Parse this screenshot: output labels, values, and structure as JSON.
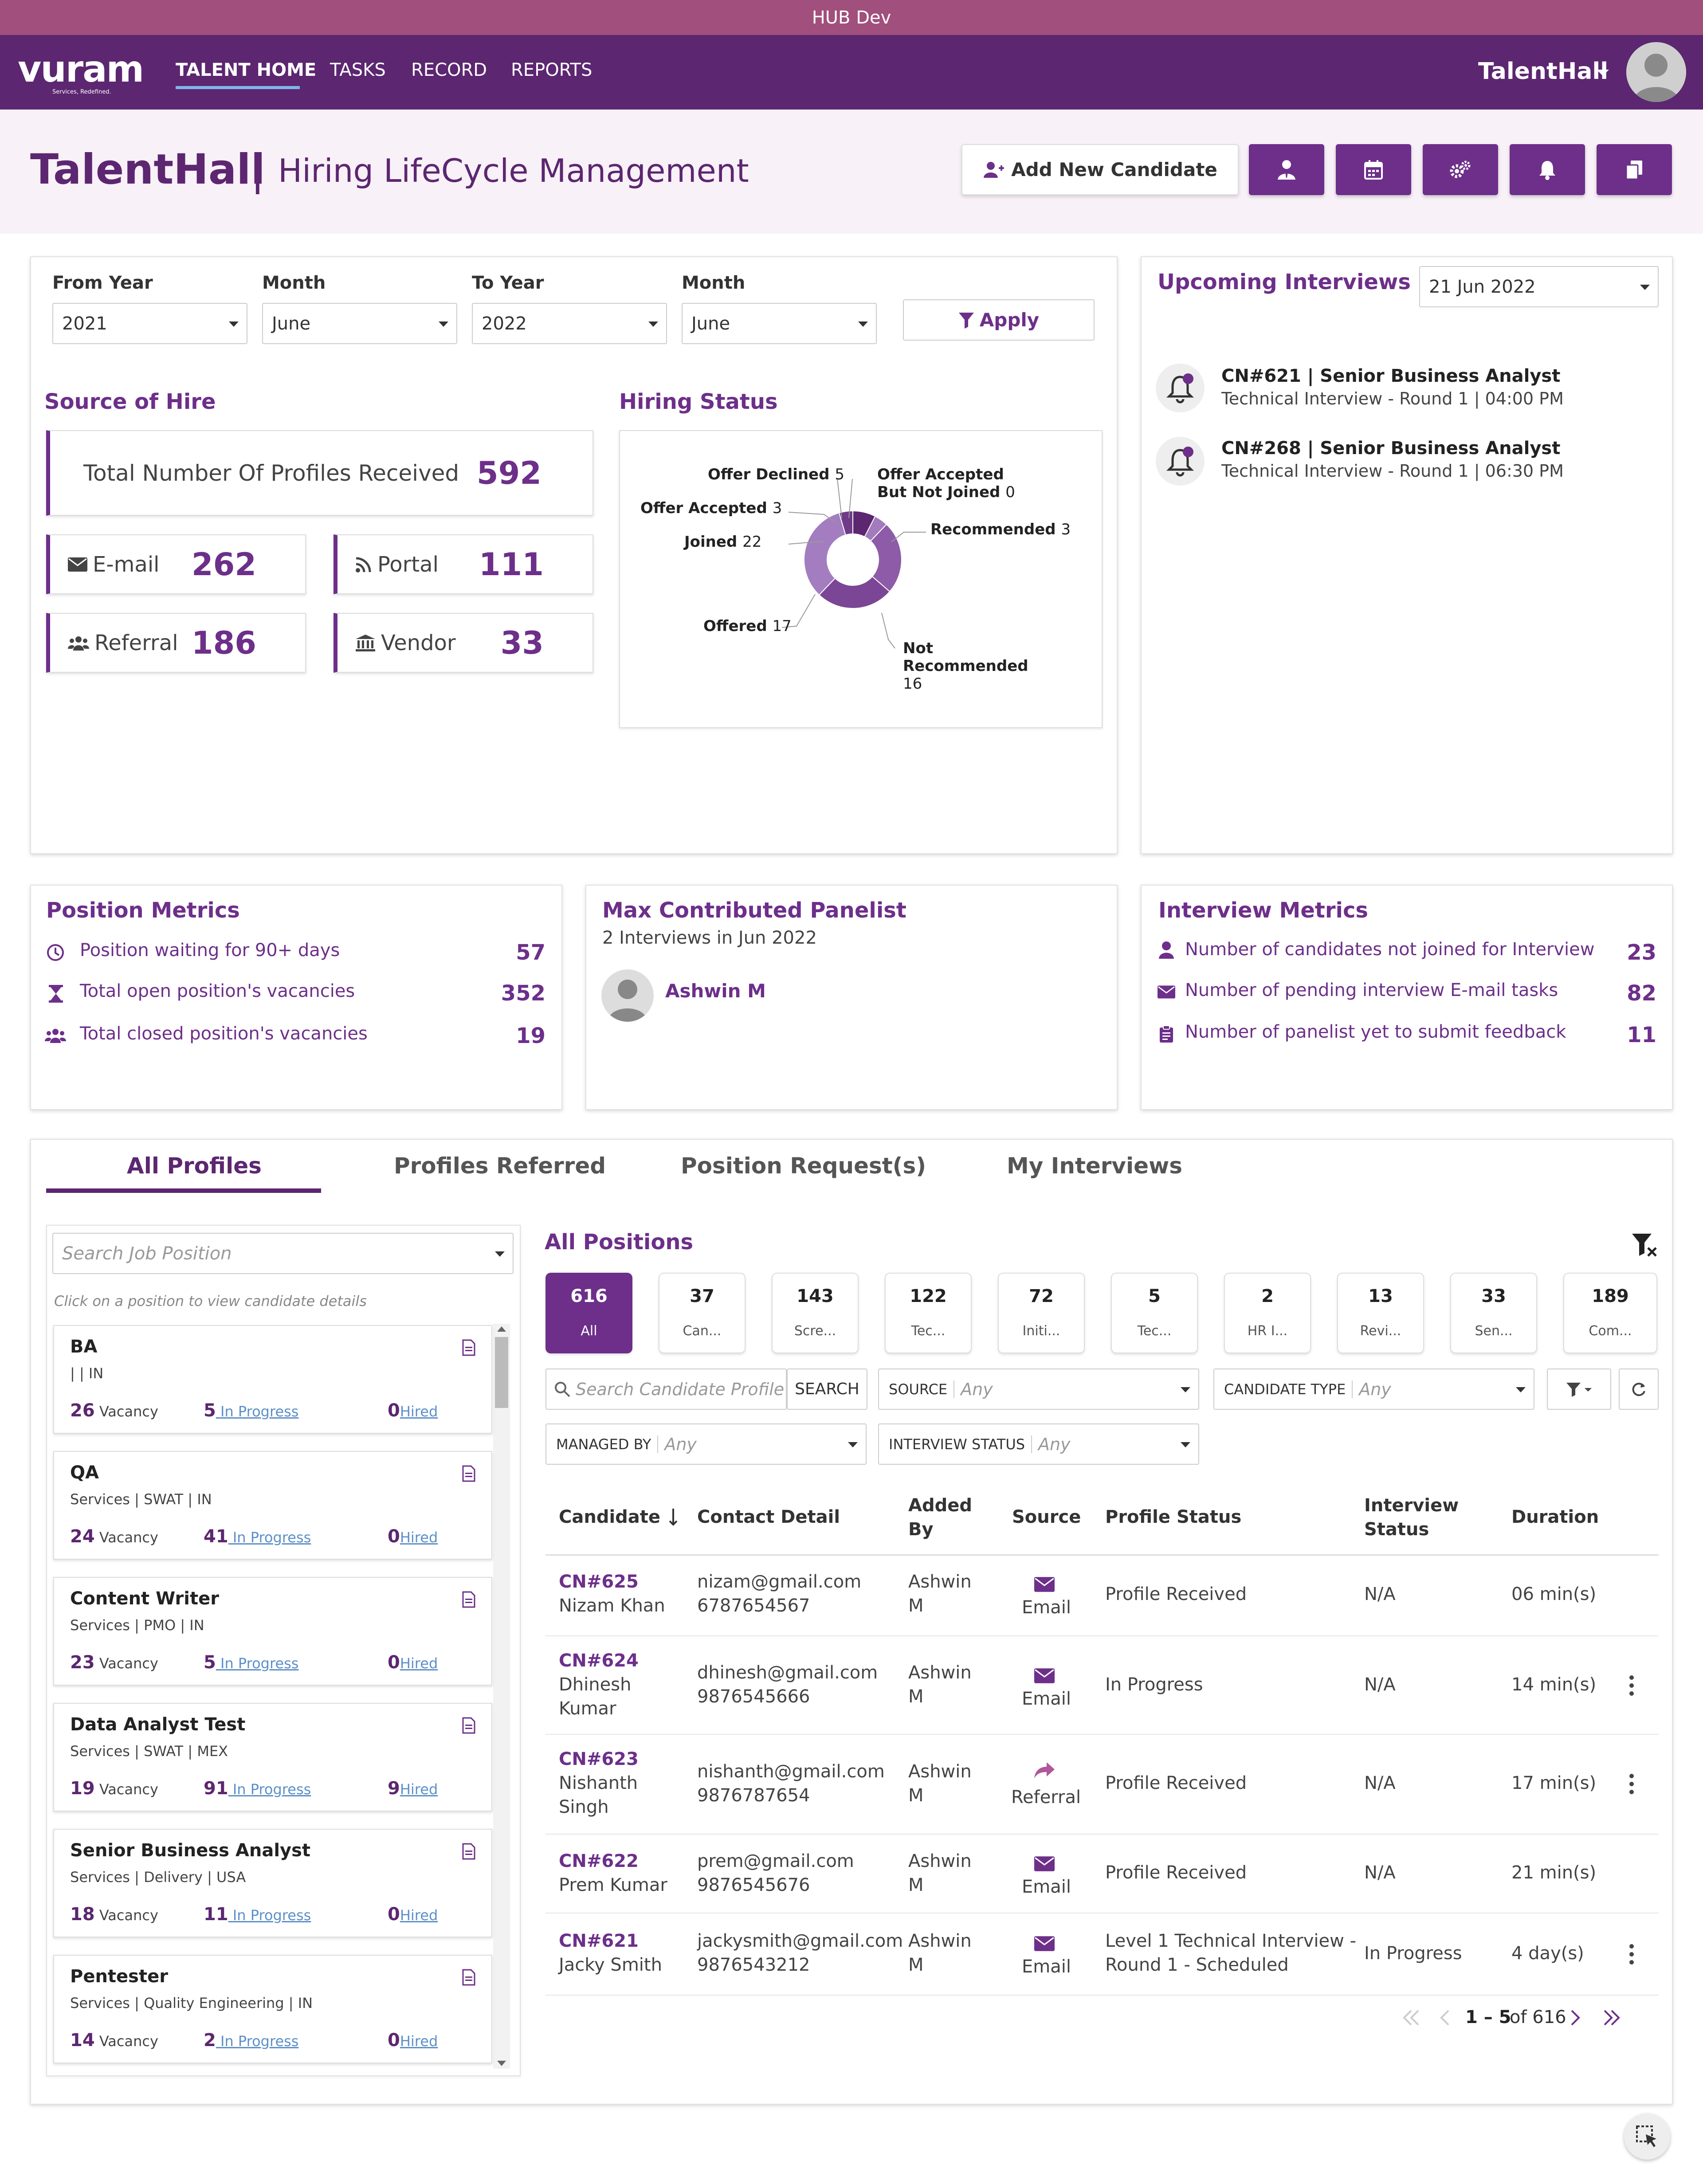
{
  "window": {
    "title": "HUB Dev"
  },
  "nav": {
    "logo_text": "vuram",
    "logo_tagline": "Services, Redefined.",
    "items": [
      {
        "label": "TALENT HOME"
      },
      {
        "label": "TASKS"
      },
      {
        "label": "RECORD"
      },
      {
        "label": "REPORTS"
      }
    ],
    "user": "TalentHall"
  },
  "header": {
    "title": "TalentHall",
    "separator": "|",
    "subtitle": "Hiring LifeCycle Management",
    "add_candidate_label": "Add New Candidate"
  },
  "filters": {
    "from_year_label": "From Year",
    "from_year": "2021",
    "from_month_label": "Month",
    "from_month": "June",
    "to_year_label": "To Year",
    "to_year": "2022",
    "to_month_label": "Month",
    "to_month": "June",
    "apply_label": "Apply"
  },
  "source_of_hire": {
    "title": "Source of Hire",
    "total_label": "Total Number Of Profiles Received",
    "total": "592",
    "email_label": "E-mail",
    "email": "262",
    "portal_label": "Portal",
    "portal": "111",
    "referral_label": "Referral",
    "referral": "186",
    "vendor_label": "Vendor",
    "vendor": "33"
  },
  "hiring_status": {
    "title": "Hiring Status",
    "labels": {
      "offer_declined": "Offer Declined",
      "offer_declined_v": "5",
      "offer_accepted_nj": "Offer Accepted But Not Joined",
      "offer_accepted_nj_l1": "Offer Accepted",
      "offer_accepted_nj_l2": "But Not Joined",
      "offer_accepted_nj_v": "0",
      "offer_accepted": "Offer Accepted",
      "offer_accepted_v": "3",
      "recommended": "Recommended",
      "recommended_v": "3",
      "joined": "Joined",
      "joined_v": "22",
      "offered": "Offered",
      "offered_v": "17",
      "not_recommended_l1": "Not",
      "not_recommended_l2": "Recommended",
      "not_recommended_v": "16"
    }
  },
  "chart_data": {
    "type": "pie",
    "title": "Hiring Status",
    "categories": [
      "Offer Declined",
      "Offer Accepted But Not Joined",
      "Recommended",
      "Not Recommended",
      "Offered",
      "Joined",
      "Offer Accepted"
    ],
    "values": [
      5,
      0,
      3,
      16,
      17,
      22,
      3
    ],
    "colors": [
      "#5c2670",
      "#6d3584",
      "#a27bbd",
      "#8d5ba8",
      "#7b4696",
      "#a37dc0",
      "#6f3a88"
    ]
  },
  "upcoming": {
    "title": "Upcoming Interviews",
    "date": "21 Jun 2022",
    "items": [
      {
        "title": "CN#621 | Senior Business Analyst",
        "detail": "Technical Interview - Round 1 | 04:00 PM"
      },
      {
        "title": "CN#268 | Senior Business Analyst",
        "detail": "Technical Interview - Round 1 | 06:30 PM"
      }
    ]
  },
  "position_metrics": {
    "title": "Position Metrics",
    "rows": [
      {
        "label": "Position waiting for 90+ days",
        "value": "57"
      },
      {
        "label": "Total open position's vacancies",
        "value": "352"
      },
      {
        "label": "Total closed position's vacancies",
        "value": "19"
      }
    ]
  },
  "max_panelist": {
    "title": "Max Contributed Panelist",
    "subtitle": "2 Interviews in Jun 2022",
    "name": "Ashwin M"
  },
  "interview_metrics": {
    "title": "Interview Metrics",
    "rows": [
      {
        "label": "Number of candidates not joined for Interview",
        "value": "23"
      },
      {
        "label": "Number of pending interview E-mail tasks",
        "value": "82"
      },
      {
        "label": "Number of panelist yet to submit feedback",
        "value": "11"
      }
    ]
  },
  "tabs": [
    {
      "label": "All Profiles"
    },
    {
      "label": "Profiles Referred"
    },
    {
      "label": "Position Request(s)"
    },
    {
      "label": "My Interviews"
    }
  ],
  "positions": {
    "search_placeholder": "Search Job Position",
    "hint": "Click on a position to view candidate details",
    "items": [
      {
        "title": "BA",
        "sub": "| | IN",
        "vacancy": "26",
        "vacancy_label": "Vacancy",
        "progress": "5",
        "progress_label": "In Progress",
        "hired": "0",
        "hired_label": "Hired"
      },
      {
        "title": "QA",
        "sub": "Services | SWAT | IN",
        "vacancy": "24",
        "vacancy_label": "Vacancy",
        "progress": "41",
        "progress_label": "In Progress",
        "hired": "0",
        "hired_label": "Hired"
      },
      {
        "title": "Content Writer",
        "sub": "Services | PMO | IN",
        "vacancy": "23",
        "vacancy_label": "Vacancy",
        "progress": "5",
        "progress_label": "In Progress",
        "hired": "0",
        "hired_label": "Hired"
      },
      {
        "title": "Data Analyst Test",
        "sub": "Services | SWAT | MEX",
        "vacancy": "19",
        "vacancy_label": "Vacancy",
        "progress": "91",
        "progress_label": "In Progress",
        "hired": "9",
        "hired_label": "Hired"
      },
      {
        "title": "Senior Business Analyst",
        "sub": "Services | Delivery | USA",
        "vacancy": "18",
        "vacancy_label": "Vacancy",
        "progress": "11",
        "progress_label": "In Progress",
        "hired": "0",
        "hired_label": "Hired"
      },
      {
        "title": "Pentester",
        "sub": "Services | Quality Engineering | IN",
        "vacancy": "14",
        "vacancy_label": "Vacancy",
        "progress": "2",
        "progress_label": "In Progress",
        "hired": "0",
        "hired_label": "Hired"
      }
    ]
  },
  "all_positions": {
    "title": "All Positions",
    "chips": [
      {
        "count": "616",
        "label": "All"
      },
      {
        "count": "37",
        "label": "Can..."
      },
      {
        "count": "143",
        "label": "Scre..."
      },
      {
        "count": "122",
        "label": "Tec..."
      },
      {
        "count": "72",
        "label": "Initi..."
      },
      {
        "count": "5",
        "label": "Tec..."
      },
      {
        "count": "2",
        "label": "HR I..."
      },
      {
        "count": "13",
        "label": "Revi..."
      },
      {
        "count": "33",
        "label": "Sen..."
      },
      {
        "count": "189",
        "label": "Com..."
      }
    ],
    "search_placeholder": "Search Candidate Profile",
    "search_btn": "SEARCH",
    "source_label": "SOURCE",
    "source_value": "Any",
    "ctype_label": "CANDIDATE TYPE",
    "ctype_value": "Any",
    "managed_label": "MANAGED BY",
    "managed_value": "Any",
    "istatus_label": "INTERVIEW STATUS",
    "istatus_value": "Any"
  },
  "table": {
    "headers": {
      "candidate": "Candidate",
      "contact": "Contact Detail",
      "added_l1": "Added",
      "added_l2": "By",
      "source": "Source",
      "profile_status": "Profile Status",
      "istatus_l1": "Interview",
      "istatus_l2": "Status",
      "duration": "Duration"
    },
    "rows": [
      {
        "id": "CN#625",
        "name_l1": "Nizam Khan",
        "name_l2": "",
        "email": "nizam@gmail.com",
        "phone": "6787654567",
        "added_l1": "Ashwin",
        "added_l2": "M",
        "source": "Email",
        "status_l1": "Profile Received",
        "status_l2": "",
        "istatus": "N/A",
        "duration": "06 min(s)"
      },
      {
        "id": "CN#624",
        "name_l1": "Dhinesh",
        "name_l2": "Kumar",
        "email": "dhinesh@gmail.com",
        "phone": "9876545666",
        "added_l1": "Ashwin",
        "added_l2": "M",
        "source": "Email",
        "status_l1": "In Progress",
        "status_l2": "",
        "istatus": "N/A",
        "duration": "14 min(s)"
      },
      {
        "id": "CN#623",
        "name_l1": "Nishanth",
        "name_l2": "Singh",
        "email": "nishanth@gmail.com",
        "phone": "9876787654",
        "added_l1": "Ashwin",
        "added_l2": "M",
        "source": "Referral",
        "status_l1": "Profile Received",
        "status_l2": "",
        "istatus": "N/A",
        "duration": "17 min(s)"
      },
      {
        "id": "CN#622",
        "name_l1": "Prem Kumar",
        "name_l2": "",
        "email": "prem@gmail.com",
        "phone": "9876545676",
        "added_l1": "Ashwin",
        "added_l2": "M",
        "source": "Email",
        "status_l1": "Profile Received",
        "status_l2": "",
        "istatus": "N/A",
        "duration": "21 min(s)"
      },
      {
        "id": "CN#621",
        "name_l1": "Jacky Smith",
        "name_l2": "",
        "email": "jackysmith@gmail.com",
        "phone": "9876543212",
        "added_l1": "Ashwin",
        "added_l2": "M",
        "source": "Email",
        "status_l1": "Level 1 Technical Interview -",
        "status_l2": "Round 1 - Scheduled",
        "istatus": "In Progress",
        "duration": "4 day(s)"
      }
    ]
  },
  "pagination": {
    "range": "1 – 5",
    "of": "of 616"
  },
  "colors": {
    "brand": "#5c2670",
    "topbar": "#a14f7c",
    "accent": "#6d2f8a",
    "link": "#5c8fc8"
  }
}
